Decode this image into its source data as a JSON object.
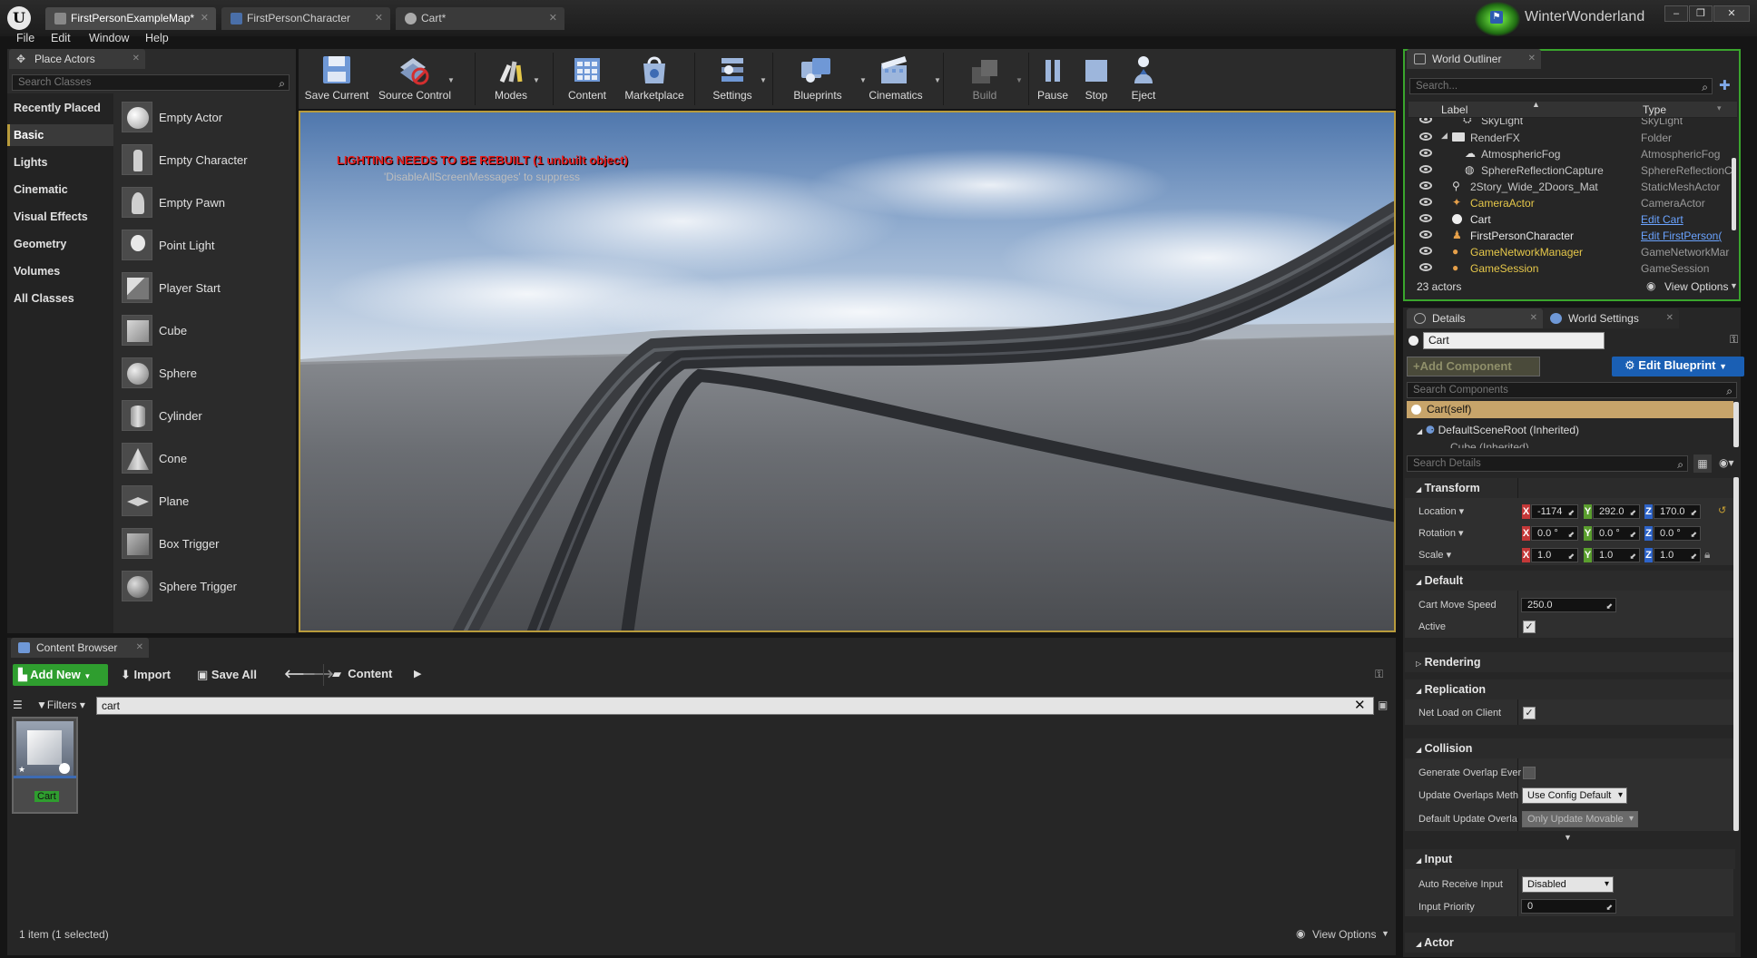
{
  "window": {
    "tabs": [
      {
        "label": "FirstPersonExampleMap*"
      },
      {
        "label": "FirstPersonCharacter"
      },
      {
        "label": "Cart*"
      }
    ],
    "project_name": "WinterWonderland",
    "controls": {
      "minimize": "–",
      "restore": "❐",
      "close": "✕"
    }
  },
  "menu": {
    "items": [
      "File",
      "Edit",
      "Window",
      "Help"
    ]
  },
  "place_actors": {
    "tab_label": "Place Actors",
    "search_placeholder": "Search Classes",
    "categories": [
      "Recently Placed",
      "Basic",
      "Lights",
      "Cinematic",
      "Visual Effects",
      "Geometry",
      "Volumes",
      "All Classes"
    ],
    "selected_category": "Basic",
    "actors": [
      "Empty Actor",
      "Empty Character",
      "Empty Pawn",
      "Point Light",
      "Player Start",
      "Cube",
      "Sphere",
      "Cylinder",
      "Cone",
      "Plane",
      "Box Trigger",
      "Sphere Trigger"
    ]
  },
  "toolbar": {
    "buttons": [
      {
        "label": "Save Current",
        "icon": "save-icon"
      },
      {
        "label": "Source Control",
        "icon": "source-control-icon"
      },
      {
        "label": "Modes",
        "icon": "modes-icon"
      },
      {
        "label": "Content",
        "icon": "content-icon"
      },
      {
        "label": "Marketplace",
        "icon": "marketplace-icon"
      },
      {
        "label": "Settings",
        "icon": "settings-icon"
      },
      {
        "label": "Blueprints",
        "icon": "blueprints-icon"
      },
      {
        "label": "Cinematics",
        "icon": "cinematics-icon"
      },
      {
        "label": "Build",
        "icon": "build-icon"
      },
      {
        "label": "Pause",
        "icon": "pause-icon"
      },
      {
        "label": "Stop",
        "icon": "stop-icon"
      },
      {
        "label": "Eject",
        "icon": "eject-icon"
      }
    ]
  },
  "viewport": {
    "warning": "LIGHTING NEEDS TO BE REBUILT (1 unbuilt object)",
    "suppress_hint": "'DisableAllScreenMessages' to suppress"
  },
  "world_outliner": {
    "tab_label": "World Outliner",
    "search_placeholder": "Search...",
    "col_label": "Label",
    "col_type": "Type",
    "rows": [
      {
        "label": "SkyLight",
        "type": "SkyLight"
      },
      {
        "label": "RenderFX",
        "type": "Folder"
      },
      {
        "label": "AtmosphericFog",
        "type": "AtmosphericFog"
      },
      {
        "label": "SphereReflectionCapture",
        "type": "SphereReflectionC"
      },
      {
        "label": "2Story_Wide_2Doors_Mat",
        "type": "StaticMeshActor"
      },
      {
        "label": "CameraActor",
        "type": "CameraActor"
      },
      {
        "label": "Cart",
        "type": "Edit Cart"
      },
      {
        "label": "FirstPersonCharacter",
        "type": "Edit FirstPerson("
      },
      {
        "label": "GameNetworkManager",
        "type": "GameNetworkMar"
      },
      {
        "label": "GameSession",
        "type": "GameSession"
      }
    ],
    "actor_count": "23 actors",
    "view_options": "View Options"
  },
  "details": {
    "tab_label": "Details",
    "world_settings_label": "World Settings",
    "object_name": "Cart",
    "add_component": "+Add Component",
    "edit_blueprint": "Edit Blueprint",
    "search_components_placeholder": "Search Components",
    "components": [
      "Cart(self)",
      "DefaultSceneRoot (Inherited)",
      "Cube (Inherited)"
    ],
    "search_details_placeholder": "Search Details",
    "sections": {
      "transform": "Transform",
      "default": "Default",
      "rendering": "Rendering",
      "replication": "Replication",
      "collision": "Collision",
      "input": "Input",
      "actor": "Actor"
    },
    "transform": {
      "location_label": "Location",
      "rotation_label": "Rotation",
      "scale_label": "Scale",
      "location": [
        "-1174",
        "292.0",
        "170.0"
      ],
      "rotation": [
        "0.0 °",
        "0.0 °",
        "0.0 °"
      ],
      "scale": [
        "1.0",
        "1.0",
        "1.0"
      ],
      "axis": [
        "X",
        "Y",
        "Z"
      ]
    },
    "default_props": {
      "cart_move_speed_label": "Cart Move Speed",
      "cart_move_speed": "250.0",
      "active_label": "Active"
    },
    "replication_props": {
      "net_load_label": "Net Load on Client"
    },
    "collision_props": {
      "gen_overlap_label": "Generate Overlap Ever",
      "update_overlaps_label": "Update Overlaps Meth",
      "update_overlaps_value": "Use Config Default",
      "default_update_label": "Default Update Overla",
      "default_update_value": "Only Update Movable"
    },
    "input_props": {
      "auto_receive_label": "Auto Receive Input",
      "auto_receive_value": "Disabled",
      "input_priority_label": "Input Priority",
      "input_priority_value": "0"
    }
  },
  "content_browser": {
    "tab_label": "Content Browser",
    "add_new": "Add New",
    "import": "Import",
    "save_all": "Save All",
    "path": "Content",
    "filters": "Filters",
    "search_value": "cart",
    "asset_name": "Cart",
    "status": "1 item (1 selected)",
    "view_options": "View Options"
  },
  "colors": {
    "accent_orange": "#b89b3c",
    "selection": "#c7a46a",
    "link_blue": "#6aa3ff",
    "warning_red": "#e81b1b",
    "add_green": "#2f9e2f",
    "edit_blueprint_blue": "#1a5fb4"
  }
}
